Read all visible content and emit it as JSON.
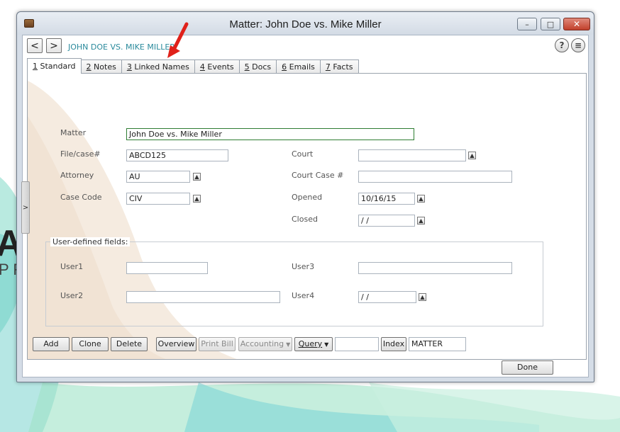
{
  "window": {
    "title": "Matter: John Doe vs. Mike Miller",
    "minimize_glyph": "–",
    "maximize_glyph": "□",
    "close_glyph": "✕"
  },
  "nav": {
    "back_glyph": "<",
    "forward_glyph": ">",
    "record_name": "JOHN DOE VS. MIKE MILLER",
    "help_glyph": "?",
    "menu_glyph": "≡"
  },
  "tabs": [
    {
      "key": "1",
      "label": " Standard",
      "active": true
    },
    {
      "key": "2",
      "label": " Notes"
    },
    {
      "key": "3",
      "label": " Linked Names"
    },
    {
      "key": "4",
      "label": " Events"
    },
    {
      "key": "5",
      "label": " Docs"
    },
    {
      "key": "6",
      "label": " Emails"
    },
    {
      "key": "7",
      "label": " Facts"
    }
  ],
  "form": {
    "matter_label": "Matter",
    "matter_value": "John Doe vs. Mike Miller",
    "filecase_label": "File/case#",
    "filecase_value": "ABCD125",
    "attorney_label": "Attorney",
    "attorney_value": "AU",
    "casecode_label": "Case Code",
    "casecode_value": "CIV",
    "court_label": "Court",
    "court_value": "",
    "courtcase_label": "Court Case #",
    "courtcase_value": "",
    "opened_label": "Opened",
    "opened_value": "10/16/15",
    "closed_label": "Closed",
    "closed_value": " /  /",
    "dropdown_glyph": "▲"
  },
  "user_fields": {
    "group_title": "User-defined fields:",
    "user1_label": "User1",
    "user1_value": "",
    "user2_label": "User2",
    "user2_value": "",
    "user3_label": "User3",
    "user3_value": "",
    "user4_label": "User4",
    "user4_value": " /  /"
  },
  "toolbar": {
    "add": "Add",
    "clone": "Clone",
    "delete": "Delete",
    "overview": "Overview",
    "print_bill": "Print Bill",
    "accounting": "Accounting",
    "query": "Query",
    "index": "Index",
    "index_value": "MATTER",
    "dropdown_glyph": "▼"
  },
  "footer": {
    "done": "Done"
  },
  "side_handle": ">",
  "background": {
    "large_letter": "A",
    "small_letters": "P F"
  },
  "colors": {
    "accent_teal": "#2a8a9c",
    "annotation_red": "#e0211a",
    "focus_green": "#2e7d32"
  }
}
